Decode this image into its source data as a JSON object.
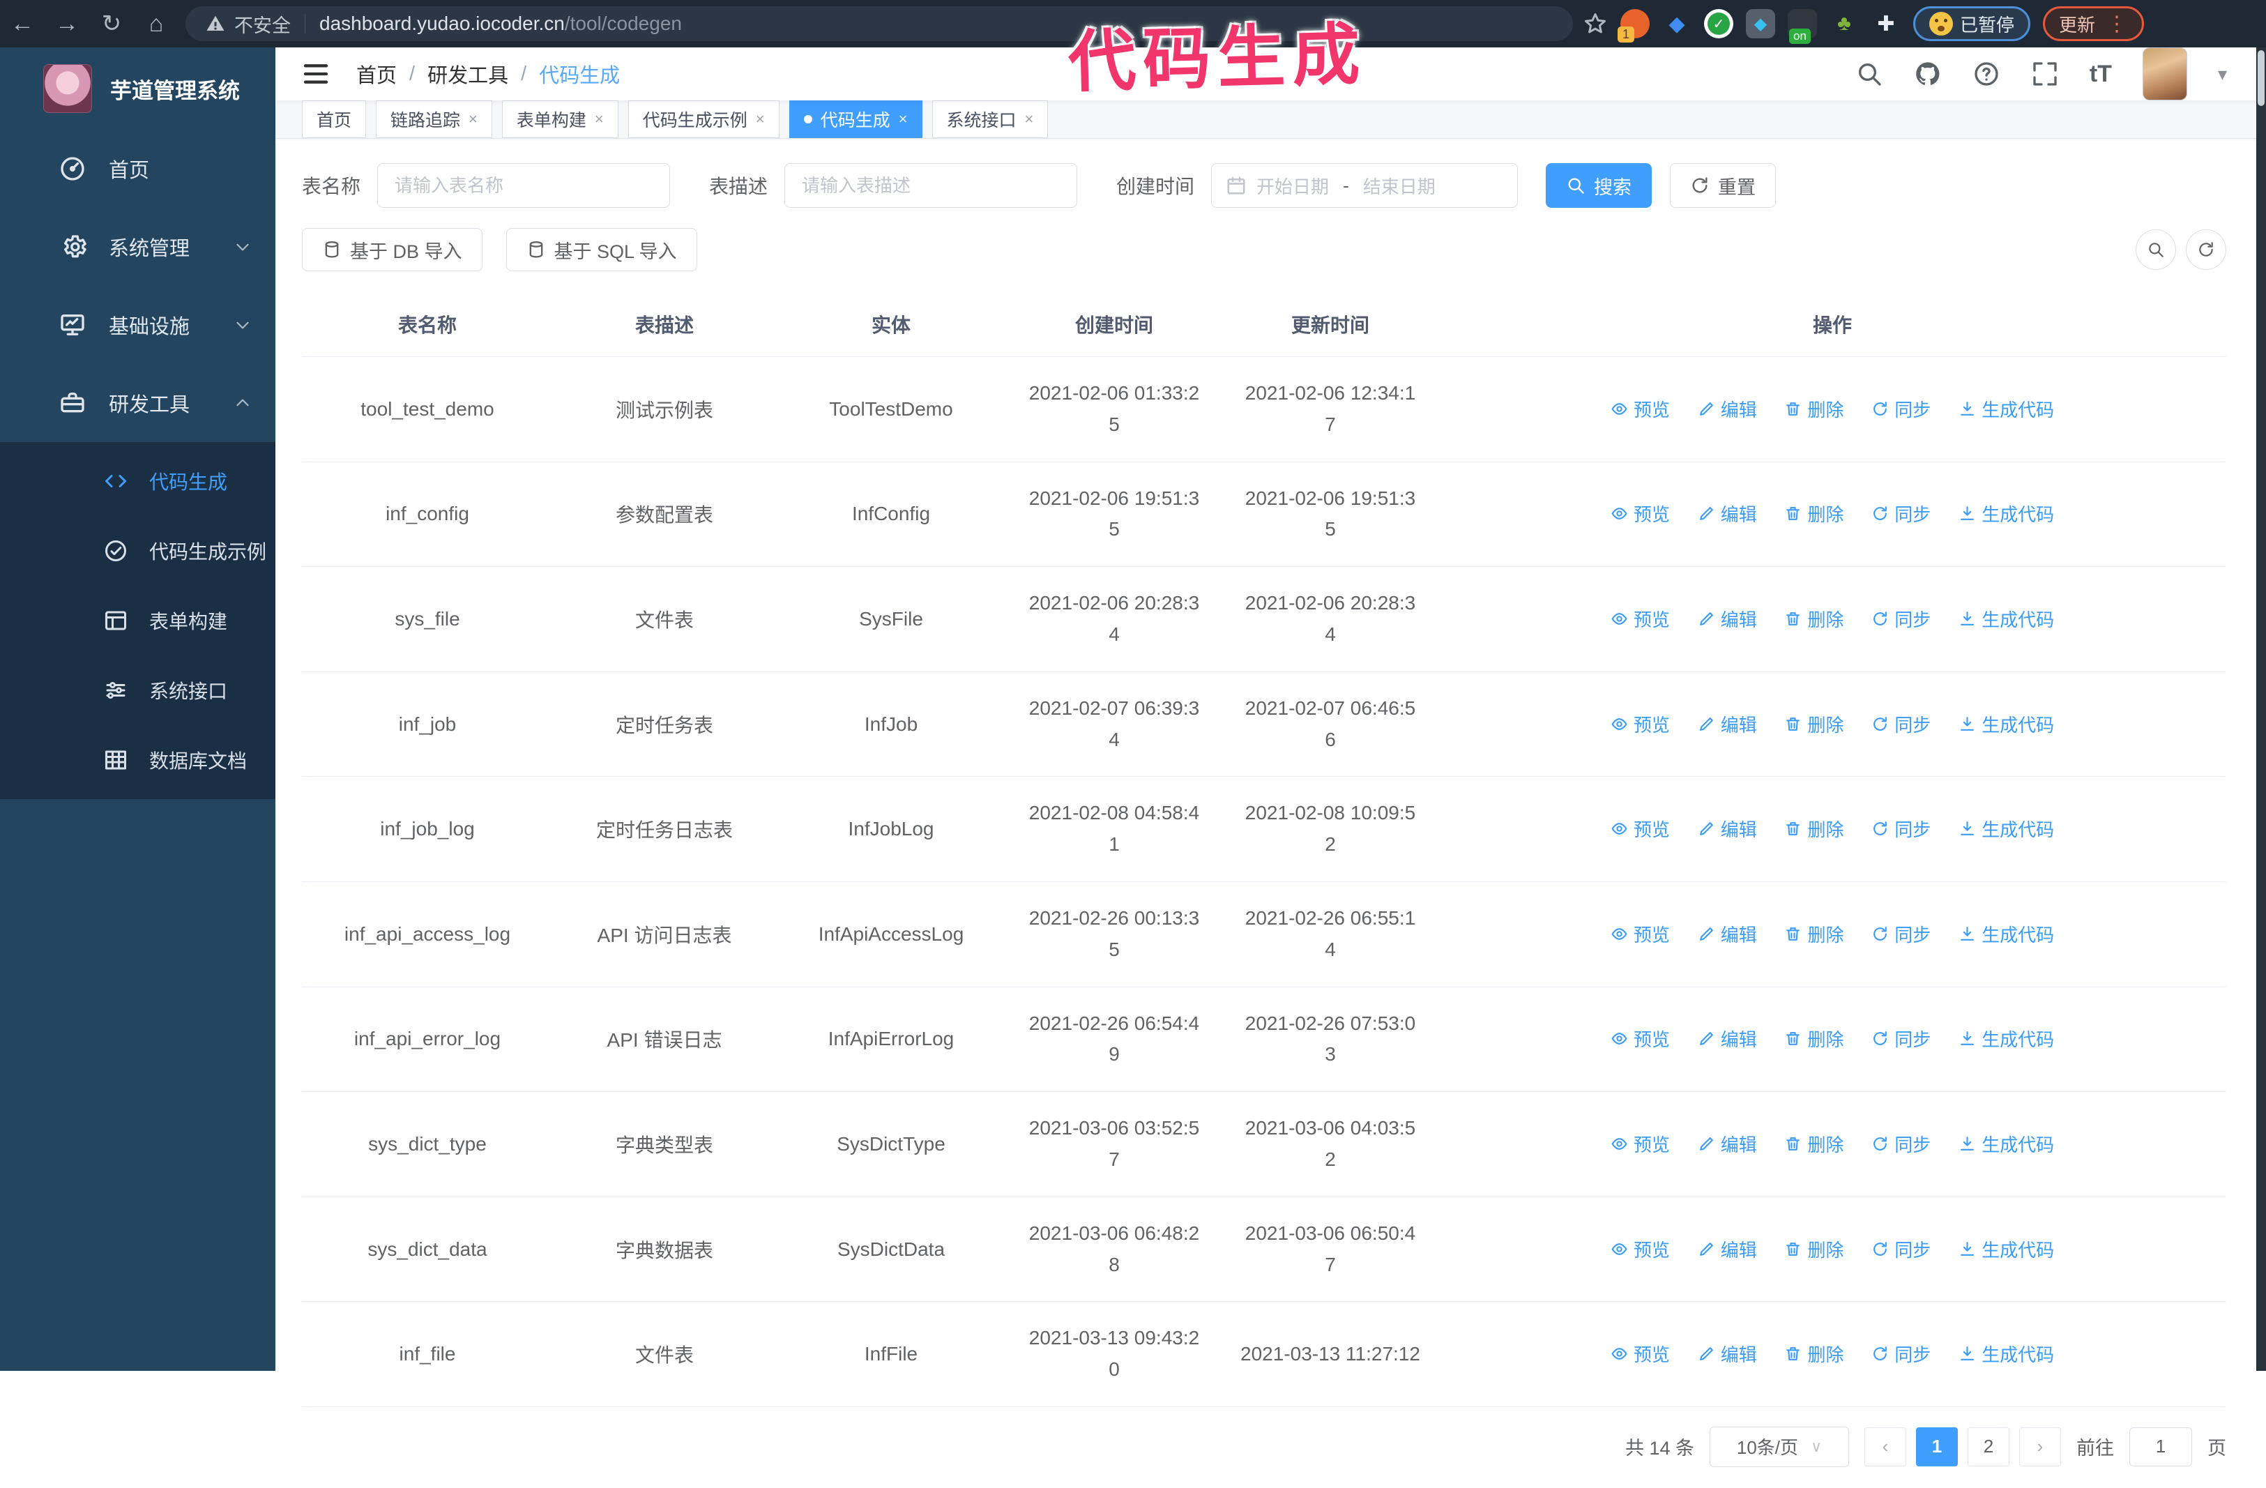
{
  "watermark": "代码生成",
  "browser": {
    "not_secure": "不安全",
    "url_host": "dashboard.yudao.iocoder.cn",
    "url_path": "/tool/codegen",
    "paused_badge": "已暂停",
    "update_button": "更新",
    "ext_badge": "1",
    "ext_on": "on"
  },
  "sidebar": {
    "app_title": "芋道管理系统",
    "items": [
      {
        "label": "首页",
        "icon": "gauge-icon"
      },
      {
        "label": "系统管理",
        "icon": "gear-icon"
      },
      {
        "label": "基础设施",
        "icon": "monitor-icon"
      },
      {
        "label": "研发工具",
        "icon": "toolbox-icon"
      }
    ],
    "submenu": [
      {
        "label": "代码生成",
        "icon": "code-icon"
      },
      {
        "label": "代码生成示例",
        "icon": "check-circle-icon"
      },
      {
        "label": "表单构建",
        "icon": "form-icon"
      },
      {
        "label": "系统接口",
        "icon": "sliders-icon"
      },
      {
        "label": "数据库文档",
        "icon": "database-icon"
      }
    ]
  },
  "topbar": {
    "breadcrumb": [
      "首页",
      "研发工具",
      "代码生成"
    ]
  },
  "tabs": [
    {
      "label": "首页"
    },
    {
      "label": "链路追踪"
    },
    {
      "label": "表单构建"
    },
    {
      "label": "代码生成示例"
    },
    {
      "label": "代码生成"
    },
    {
      "label": "系统接口"
    }
  ],
  "filters": {
    "table_name_label": "表名称",
    "table_name_placeholder": "请输入表名称",
    "table_desc_label": "表描述",
    "table_desc_placeholder": "请输入表描述",
    "create_time_label": "创建时间",
    "start_placeholder": "开始日期",
    "range_separator": "-",
    "end_placeholder": "结束日期",
    "search_label": "搜索",
    "reset_label": "重置"
  },
  "toolbar": {
    "db_import_label": "基于 DB 导入",
    "sql_import_label": "基于 SQL 导入"
  },
  "table": {
    "columns": [
      "表名称",
      "表描述",
      "实体",
      "创建时间",
      "更新时间",
      "操作"
    ],
    "actions": [
      "预览",
      "编辑",
      "删除",
      "同步",
      "生成代码"
    ],
    "rows": [
      {
        "name": "tool_test_demo",
        "desc": "测试示例表",
        "entity": "ToolTestDemo",
        "created": "2021-02-06 01:33:25",
        "updated": "2021-02-06 12:34:17"
      },
      {
        "name": "inf_config",
        "desc": "参数配置表",
        "entity": "InfConfig",
        "created": "2021-02-06 19:51:35",
        "updated": "2021-02-06 19:51:35"
      },
      {
        "name": "sys_file",
        "desc": "文件表",
        "entity": "SysFile",
        "created": "2021-02-06 20:28:34",
        "updated": "2021-02-06 20:28:34"
      },
      {
        "name": "inf_job",
        "desc": "定时任务表",
        "entity": "InfJob",
        "created": "2021-02-07 06:39:34",
        "updated": "2021-02-07 06:46:56"
      },
      {
        "name": "inf_job_log",
        "desc": "定时任务日志表",
        "entity": "InfJobLog",
        "created": "2021-02-08 04:58:41",
        "updated": "2021-02-08 10:09:52"
      },
      {
        "name": "inf_api_access_log",
        "desc": "API 访问日志表",
        "entity": "InfApiAccessLog",
        "created": "2021-02-26 00:13:35",
        "updated": "2021-02-26 06:55:14"
      },
      {
        "name": "inf_api_error_log",
        "desc": "API 错误日志",
        "entity": "InfApiErrorLog",
        "created": "2021-02-26 06:54:49",
        "updated": "2021-02-26 07:53:03"
      },
      {
        "name": "sys_dict_type",
        "desc": "字典类型表",
        "entity": "SysDictType",
        "created": "2021-03-06 03:52:57",
        "updated": "2021-03-06 04:03:52"
      },
      {
        "name": "sys_dict_data",
        "desc": "字典数据表",
        "entity": "SysDictData",
        "created": "2021-03-06 06:48:28",
        "updated": "2021-03-06 06:50:47"
      },
      {
        "name": "inf_file",
        "desc": "文件表",
        "entity": "InfFile",
        "created": "2021-03-13 09:43:20",
        "updated": "2021-03-13 11:27:12"
      }
    ]
  },
  "pagination": {
    "total": "共 14 条",
    "page_size": "10条/页",
    "page_1": "1",
    "page_2": "2",
    "goto_label": "前往",
    "goto_value": "1",
    "page_unit": "页"
  },
  "colors": {
    "accent": "#409eff",
    "sidebar": "#234560",
    "submenu": "#1a2f44",
    "watermark_pink": "#f2366c"
  }
}
